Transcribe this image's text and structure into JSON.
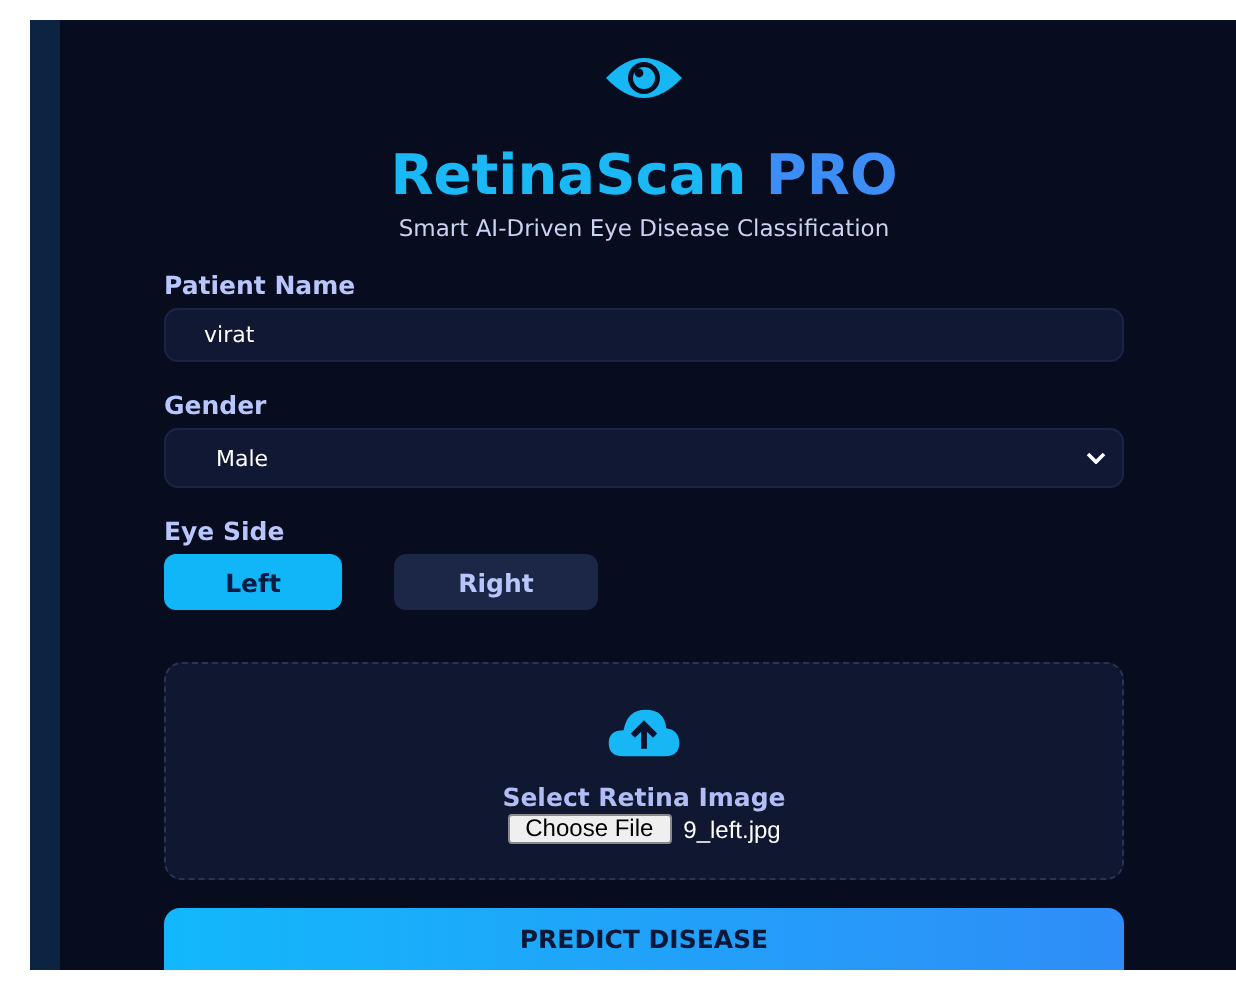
{
  "header": {
    "title": "RetinaScan",
    "title_suffix": "PRO",
    "subtitle": "Smart AI-Driven Eye Disease Classification"
  },
  "fields": [
    {
      "kind": "text",
      "label": "Patient Name",
      "value": "virat"
    },
    {
      "kind": "select",
      "label": "Gender",
      "value": "Male"
    }
  ],
  "eye_side": {
    "label": "Eye Side",
    "options": [
      {
        "label": "Left",
        "selected": true
      },
      {
        "label": "Right",
        "selected": false
      }
    ]
  },
  "upload": {
    "label": "Select Retina Image",
    "button": "Choose File",
    "file_name": "9_left.jpg"
  },
  "submit": {
    "label": "PREDICT DISEASE"
  }
}
